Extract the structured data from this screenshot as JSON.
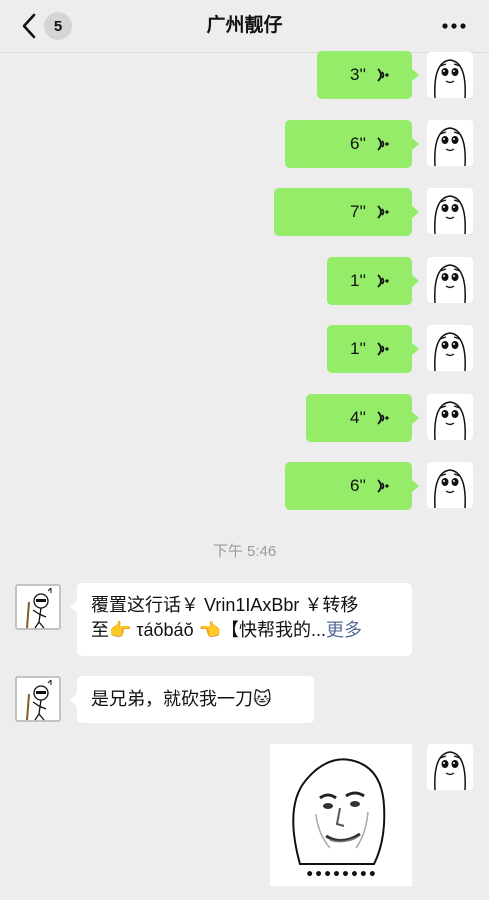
{
  "header": {
    "title": "广州靓仔",
    "unread_count": "5",
    "back_icon": "chevron-left-icon",
    "more_icon": "ellipsis-icon"
  },
  "voice_messages": [
    {
      "duration": "3''"
    },
    {
      "duration": "6''"
    },
    {
      "duration": "7''"
    },
    {
      "duration": "1''"
    },
    {
      "duration": "1''"
    },
    {
      "duration": "4''"
    },
    {
      "duration": "6''"
    }
  ],
  "timestamp": "下午 5:46",
  "incoming": [
    {
      "line1": "覆置这行话￥ Vrin1IAxBbr ￥转移",
      "line2_prefix": "至👉 τáŏbáŏ 👈【快帮我的...",
      "more_label": "更多"
    },
    {
      "text": "是兄弟，就砍我一刀",
      "emoji": "🐱"
    }
  ],
  "sticker_caption": "••••••••",
  "colors": {
    "outgoing_bubble": "#95ec69",
    "incoming_bubble": "#ffffff",
    "background": "#ededed",
    "link": "#576b95"
  }
}
